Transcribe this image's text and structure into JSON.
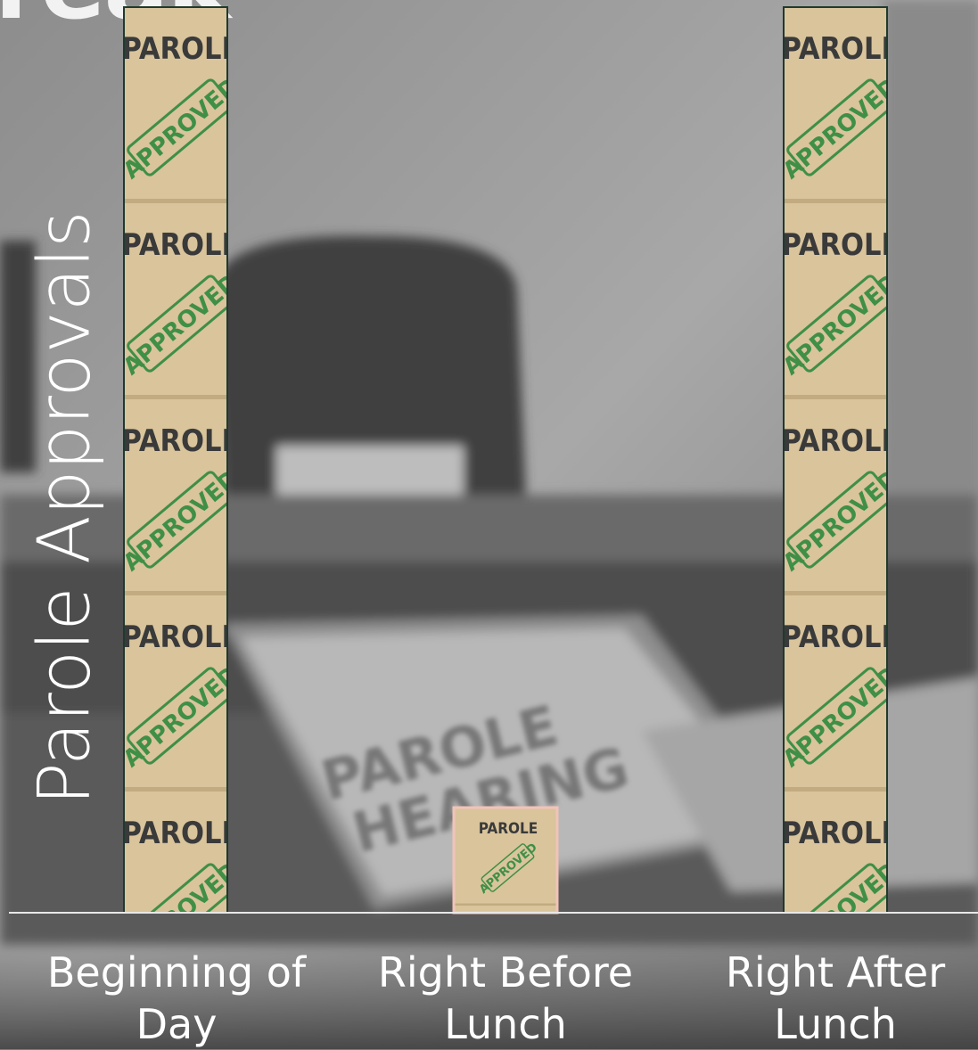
{
  "slide": {
    "title_fragment": "reak"
  },
  "background": {
    "folder_text_line1": "PAROLE",
    "folder_text_line2": "HEARING"
  },
  "tile_text": {
    "top": "PAROLE",
    "stamp": "APPROVED"
  },
  "colors": {
    "tile_fill": "#d9c49c",
    "tile_fill_dark": "#c2ab80",
    "stamp_green": "#3f8f47",
    "bar_outline": "#1f3a2e",
    "highlight_outline": "#f2c3b8",
    "axis_line": "#e8e8e8",
    "text": "#ffffff"
  },
  "chart_data": {
    "type": "bar",
    "ylabel": "Parole Approvals",
    "xlabel": "",
    "categories": [
      "Beginning of Day",
      "Right Before Lunch",
      "Right After Lunch"
    ],
    "category_lines": [
      [
        "Beginning of",
        "Day"
      ],
      [
        "Right Before",
        "Lunch"
      ],
      [
        "Right After",
        "Lunch"
      ]
    ],
    "values": [
      65,
      0,
      65
    ],
    "ylim": [
      0,
      65
    ],
    "highlighted_category": "Right Before Lunch",
    "grid": false,
    "legend": "none"
  }
}
